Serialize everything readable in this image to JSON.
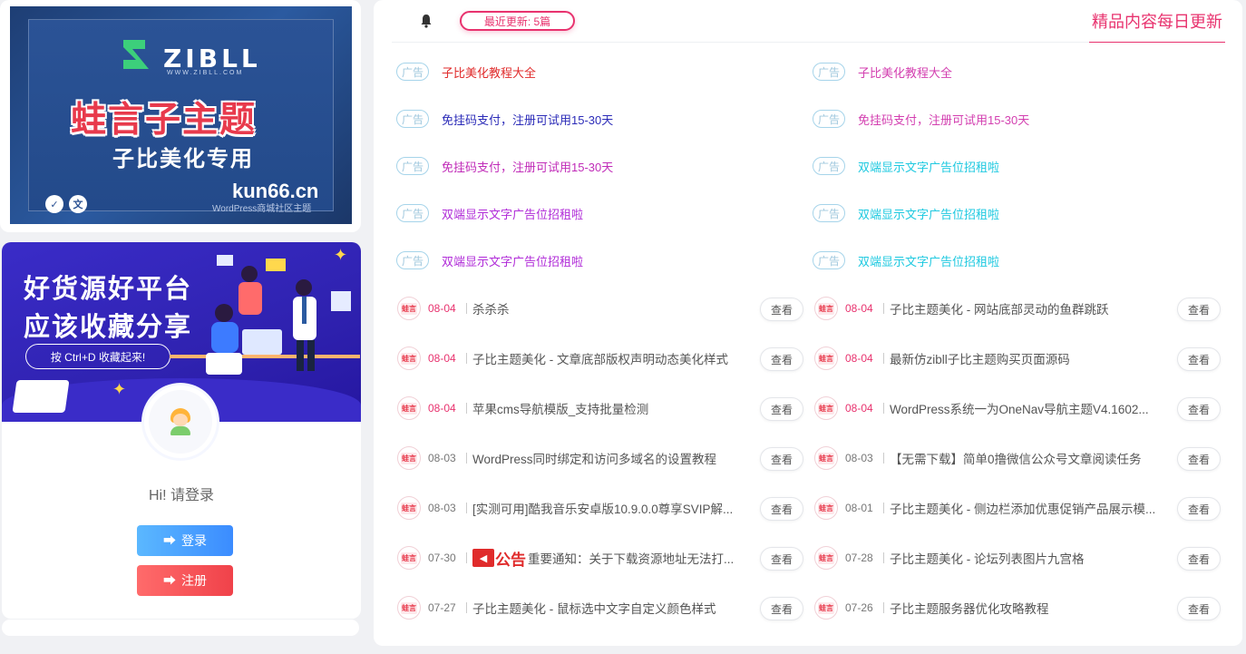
{
  "banner": {
    "logo_text": "ZIBLL",
    "logo_sub": "WWW.ZIBLL.COM",
    "title": "蛙言子主题",
    "subtitle": "子比美化专用",
    "domain": "kun66.cn",
    "footer": "WordPress商城社区主题",
    "icon1": "✓",
    "icon2": "文"
  },
  "promo": {
    "line1": "好货源好平台",
    "line2": "应该收藏分享",
    "pill": "按 Ctrl+D 收藏起来!"
  },
  "user": {
    "greeting": "Hi!  请登录",
    "login_label": "登录",
    "register_label": "注册"
  },
  "header": {
    "recent": "最近更新:  5篇",
    "daily": "精品内容每日更新"
  },
  "ad_tag": "广告",
  "ads_left": [
    {
      "text": "子比美化教程大全",
      "color": "#e02b2b"
    },
    {
      "text": "免挂码支付，注册可试用15-30天",
      "color": "#2b2bb8"
    },
    {
      "text": "免挂码支付，注册可试用15-30天",
      "color": "#c02bb8"
    },
    {
      "text": "双端显示文字广告位招租啦",
      "color": "#b02bd8"
    },
    {
      "text": "双端显示文字广告位招租啦",
      "color": "#b02bd8"
    }
  ],
  "ads_right": [
    {
      "text": "子比美化教程大全",
      "color": "#d33fb0"
    },
    {
      "text": "免挂码支付，注册可试用15-30天",
      "color": "#d33fb0"
    },
    {
      "text": "双端显示文字广告位招租啦",
      "color": "#1ec9e0"
    },
    {
      "text": "双端显示文字广告位招租啦",
      "color": "#1ec9e0"
    },
    {
      "text": "双端显示文字广告位招租啦",
      "color": "#1ec9e0"
    }
  ],
  "post_logo": "蛙言",
  "view_label": "查看",
  "announce_text": "公告",
  "posts_left": [
    {
      "date": "08-04",
      "new": true,
      "title": "杀杀杀"
    },
    {
      "date": "08-04",
      "new": true,
      "title": "子比主题美化 - 文章底部版权声明动态美化样式"
    },
    {
      "date": "08-04",
      "new": true,
      "title": "苹果cms导航模版_支持批量检测"
    },
    {
      "date": "08-03",
      "new": false,
      "title": "WordPress同时绑定和访问多域名的设置教程"
    },
    {
      "date": "08-03",
      "new": false,
      "title": "[实测可用]酷我音乐安卓版10.9.0.0尊享SVIP解..."
    },
    {
      "date": "07-30",
      "new": false,
      "title": "重要通知：关于下载资源地址无法打...",
      "announce": true
    },
    {
      "date": "07-27",
      "new": false,
      "title": "子比主题美化 - 鼠标选中文字自定义颜色样式"
    }
  ],
  "posts_right": [
    {
      "date": "08-04",
      "new": true,
      "title": "子比主题美化 - 网站底部灵动的鱼群跳跃"
    },
    {
      "date": "08-04",
      "new": true,
      "title": "最新仿zibll子比主题购买页面源码"
    },
    {
      "date": "08-04",
      "new": true,
      "title": "WordPress系统一为OneNav导航主题V4.1602..."
    },
    {
      "date": "08-03",
      "new": false,
      "title": "【无需下载】简单0撸微信公众号文章阅读任务"
    },
    {
      "date": "08-01",
      "new": false,
      "title": "子比主题美化 - 侧边栏添加优惠促销产品展示模..."
    },
    {
      "date": "07-28",
      "new": false,
      "title": "子比主题美化 - 论坛列表图片九宫格"
    },
    {
      "date": "07-26",
      "new": false,
      "title": "子比主题服务器优化攻略教程"
    }
  ],
  "colors": {
    "accent": "#e8326e",
    "new_date": "#e8326e",
    "old_date": "#777777"
  }
}
